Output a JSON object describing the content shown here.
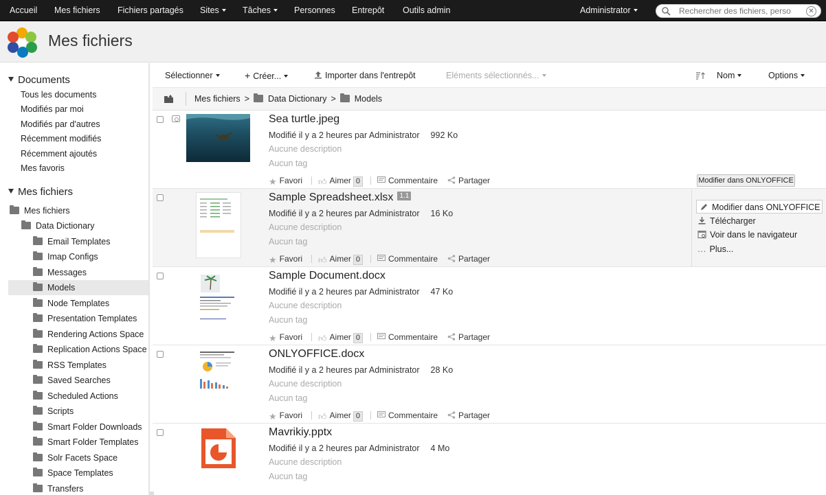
{
  "topnav": {
    "items": [
      "Accueil",
      "Mes fichiers",
      "Fichiers partagés",
      "Sites",
      "Tâches",
      "Personnes",
      "Entrepôt",
      "Outils admin"
    ],
    "user": "Administrator",
    "search_placeholder": "Rechercher des fichiers, perso"
  },
  "header": {
    "title": "Mes fichiers"
  },
  "sidebar": {
    "documents_title": "Documents",
    "documents_links": [
      "Tous les documents",
      "Modifiés par moi",
      "Modifiés par d'autres",
      "Récemment modifiés",
      "Récemment ajoutés",
      "Mes favoris"
    ],
    "myfiles_title": "Mes fichiers",
    "tree_root": "Mes fichiers",
    "tree_folder": "Data Dictionary",
    "tree_children": [
      "Email Templates",
      "Imap Configs",
      "Messages",
      "Models",
      "Node Templates",
      "Presentation Templates",
      "Rendering Actions Space",
      "Replication Actions Space",
      "RSS Templates",
      "Saved Searches",
      "Scheduled Actions",
      "Scripts",
      "Smart Folder Downloads",
      "Smart Folder Templates",
      "Solr Facets Space",
      "Space Templates",
      "Transfers"
    ],
    "selected": "Models"
  },
  "toolbar": {
    "select": "Sélectionner",
    "create": "Créer...",
    "import": "Importer dans l'entrepôt",
    "selected_items": "Eléments sélectionnés...",
    "sort": "Nom",
    "options": "Options"
  },
  "breadcrumb": {
    "items": [
      "Mes fichiers",
      "Data Dictionary",
      "Models"
    ]
  },
  "labels": {
    "no_description": "Aucune description",
    "no_tag": "Aucun tag",
    "favorite": "Favori",
    "like": "Aimer",
    "like_count": "0",
    "comment": "Commentaire",
    "share": "Partager"
  },
  "files": [
    {
      "name": "Sea turtle.jpeg",
      "modified": "Modifié il y a 2 heures par Administrator",
      "size": "992 Ko",
      "version": ""
    },
    {
      "name": "Sample Spreadsheet.xlsx",
      "modified": "Modifié il y a 2 heures par Administrator",
      "size": "16 Ko",
      "version": "1.1"
    },
    {
      "name": "Sample Document.docx",
      "modified": "Modifié il y a 2 heures par Administrator",
      "size": "47 Ko",
      "version": ""
    },
    {
      "name": "ONLYOFFICE.docx",
      "modified": "Modifié il y a 2 heures par Administrator",
      "size": "28 Ko",
      "version": ""
    },
    {
      "name": "Mavrikiy.pptx",
      "modified": "Modifié il y a 2 heures par Administrator",
      "size": "4 Mo",
      "version": ""
    }
  ],
  "row_actions": {
    "tooltip": "Modifier dans ONLYOFFICE",
    "edit": "Modifier dans ONLYOFFICE",
    "download": "Télécharger",
    "view_browser": "Voir dans le navigateur",
    "more": "Plus..."
  },
  "colors": {
    "topbar": "#1b1b1b",
    "pptx_orange": "#e8562a"
  }
}
